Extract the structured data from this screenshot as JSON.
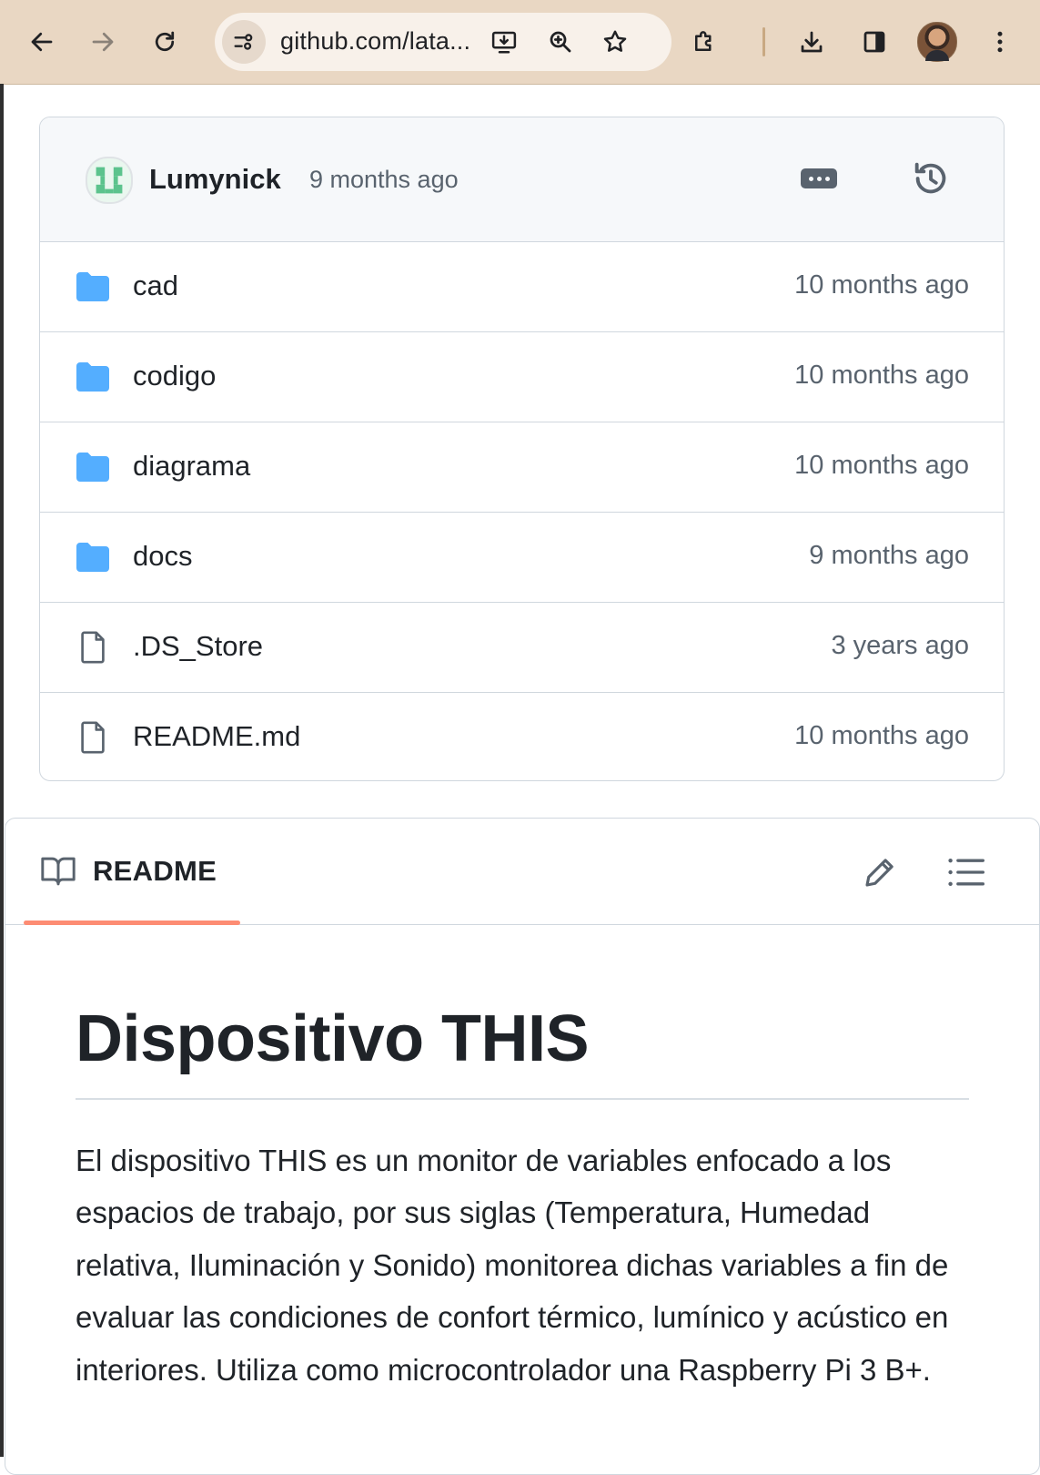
{
  "browser": {
    "url": "github.com/lata...",
    "icons": [
      "back-arrow-icon",
      "forward-arrow-icon",
      "reload-icon",
      "site-settings-icon",
      "install-app-icon",
      "zoom-icon",
      "star-icon",
      "extensions-icon",
      "download-icon",
      "side-panel-icon",
      "profile-avatar",
      "menu-dots-icon"
    ]
  },
  "commit": {
    "author": "Lumynick",
    "age": "9 months ago"
  },
  "files": [
    {
      "name": "cad",
      "type": "folder",
      "age": "10 months ago"
    },
    {
      "name": "codigo",
      "type": "folder",
      "age": "10 months ago"
    },
    {
      "name": "diagrama",
      "type": "folder",
      "age": "10 months ago"
    },
    {
      "name": "docs",
      "type": "folder",
      "age": "9 months ago"
    },
    {
      "name": ".DS_Store",
      "type": "file",
      "age": "3 years ago"
    },
    {
      "name": "README.md",
      "type": "file",
      "age": "10 months ago"
    }
  ],
  "readme": {
    "tab_label": "README",
    "title": "Dispositivo THIS",
    "paragraph": "El dispositivo THIS es un monitor de variables enfocado a los espacios de trabajo, por sus siglas (Temperatura, Humedad relativa, Iluminación y Sonido) monitorea dichas variables a fin de evaluar las condiciones de confort térmico, lumínico y acústico en interiores. Utiliza como microcontrolador una Raspberry Pi 3 B+."
  },
  "colors": {
    "toolbar": "#e9d7c3",
    "folder": "#54aeff",
    "tab_underline": "#fd8c73",
    "muted_text": "#59636e",
    "border": "#d0d7de"
  }
}
